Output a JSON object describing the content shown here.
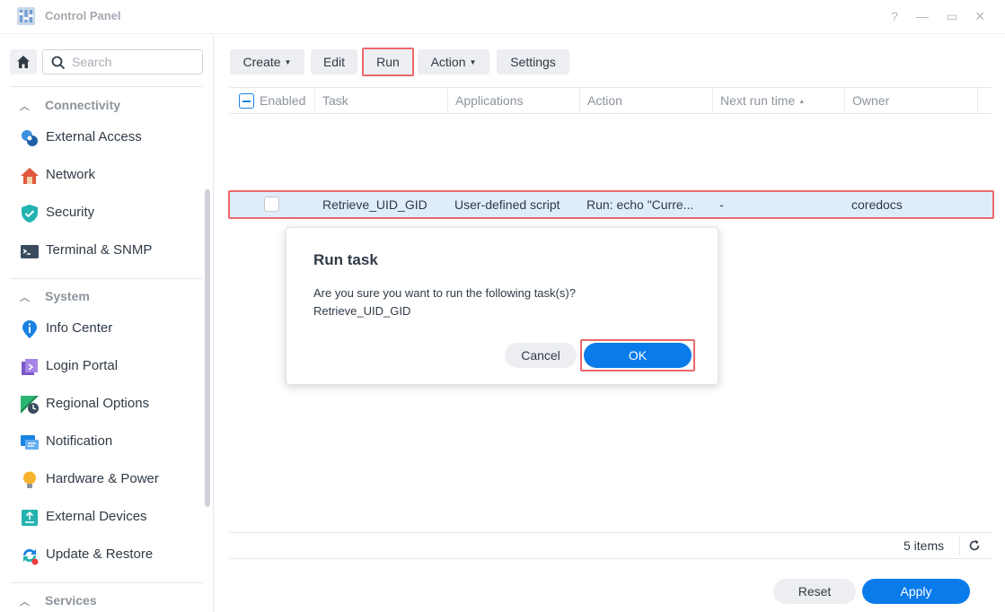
{
  "window": {
    "title": "Control Panel",
    "controls": {
      "help": "?",
      "minimize": "—",
      "maximize": "▭",
      "close": "✕"
    }
  },
  "sidebar": {
    "search_placeholder": "Search",
    "sections": [
      {
        "label": "Connectivity",
        "items": [
          "External Access",
          "Network",
          "Security",
          "Terminal & SNMP"
        ]
      },
      {
        "label": "System",
        "items": [
          "Info Center",
          "Login Portal",
          "Regional Options",
          "Notification",
          "Hardware & Power",
          "External Devices",
          "Update & Restore"
        ]
      },
      {
        "label": "Services",
        "items": []
      }
    ]
  },
  "toolbar": {
    "create": "Create",
    "edit": "Edit",
    "run": "Run",
    "action": "Action",
    "settings": "Settings"
  },
  "table": {
    "columns": [
      "Enabled",
      "Task",
      "Applications",
      "Action",
      "Next run time",
      "Owner"
    ],
    "sort_indicator": "▲",
    "selected_row": {
      "task": "Retrieve_UID_GID",
      "application": "User-defined script",
      "action": "Run: echo \"Curre...",
      "next_run_time": "-",
      "owner": "coredocs"
    }
  },
  "footer": {
    "items_count": "5 items",
    "reset": "Reset",
    "apply": "Apply"
  },
  "dialog": {
    "title": "Run task",
    "message": "Are you sure you want to run the following task(s)?",
    "task_name": "Retrieve_UID_GID",
    "cancel": "Cancel",
    "ok": "OK"
  },
  "colors": {
    "accent": "#0a7bea",
    "highlight_box": "#e9686b",
    "selected_row": "#dfedfb"
  }
}
